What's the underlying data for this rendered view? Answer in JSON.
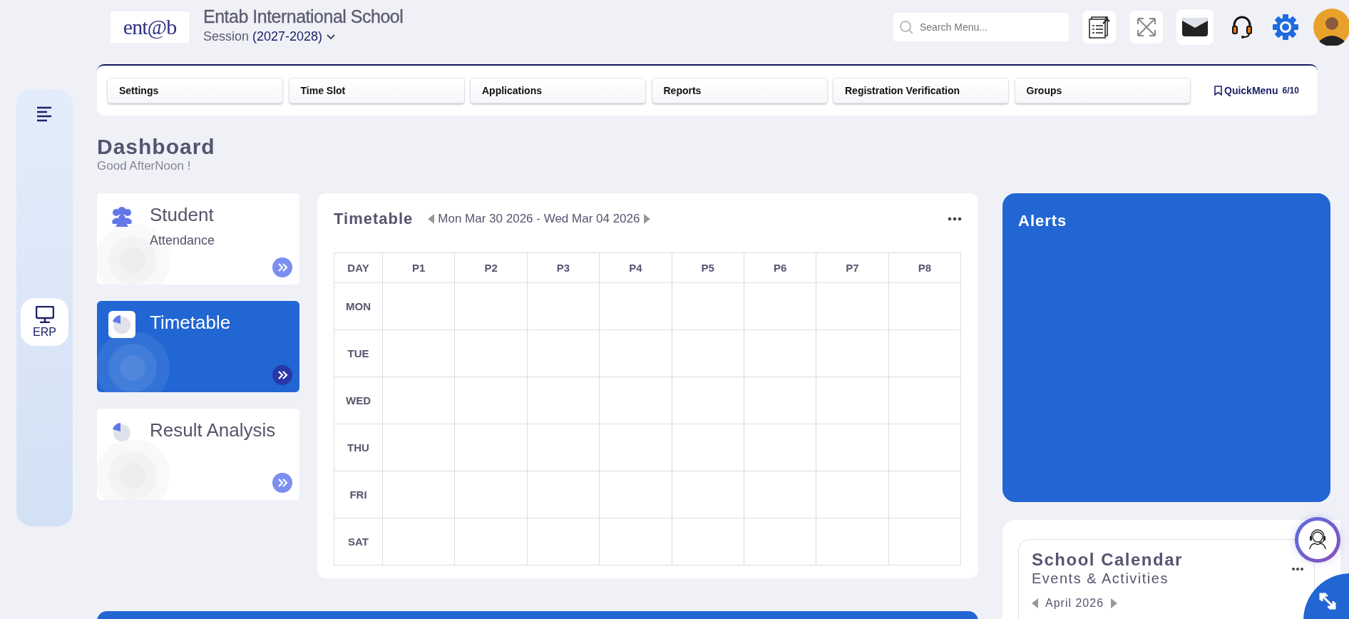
{
  "header": {
    "logo": "ent@b",
    "school_name": "Entab International School",
    "session_label": "Session",
    "session_value": "(2027-2028)"
  },
  "search": {
    "placeholder": "Search Menu..."
  },
  "sidebar": {
    "items": [
      {
        "label": "ERP",
        "selected": true
      }
    ]
  },
  "quick_menu": {
    "items": [
      "Settings",
      "Time Slot",
      "Applications",
      "Reports",
      "Registration Verification",
      "Groups"
    ],
    "label": "QuickMenu",
    "count": "6/10"
  },
  "page": {
    "title": "Dashboard",
    "greeting": "Good AfterNoon !"
  },
  "cards": [
    {
      "title": "Student",
      "subtitle": "Attendance",
      "selected": false
    },
    {
      "title": "Timetable",
      "selected": true
    },
    {
      "title": "Result Analysis",
      "selected": false
    }
  ],
  "timetable": {
    "title": "Timetable",
    "date_range": "Mon Mar 30 2026 - Wed Mar 04 2026",
    "columns": [
      "DAY",
      "P1",
      "P2",
      "P3",
      "P4",
      "P5",
      "P6",
      "P7",
      "P8"
    ],
    "rows": [
      "MON",
      "TUE",
      "WED",
      "THU",
      "FRI",
      "SAT"
    ]
  },
  "alerts": {
    "title": "Alerts"
  },
  "calendar": {
    "title": "School Calendar",
    "subtitle": "Events & Activities",
    "month": "April 2026"
  }
}
